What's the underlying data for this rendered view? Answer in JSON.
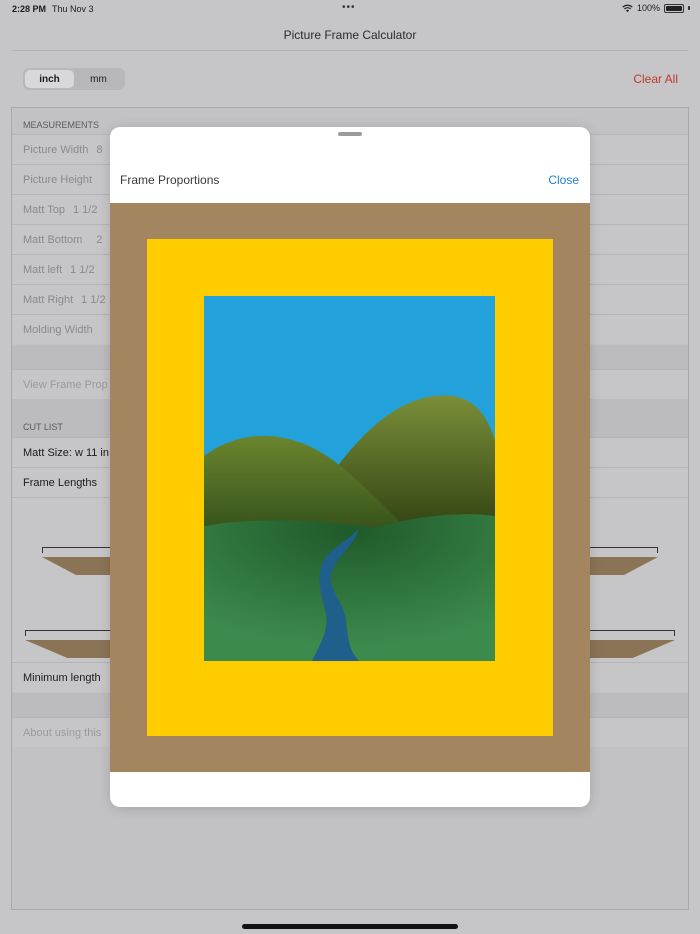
{
  "status_bar": {
    "time": "2:28 PM",
    "date": "Thu Nov 3",
    "battery": "100%",
    "icons": [
      "wifi-icon",
      "battery-icon"
    ]
  },
  "nav": {
    "title": "Picture Frame Calculator"
  },
  "units": {
    "options": [
      "inch",
      "mm"
    ],
    "selected": "inch"
  },
  "toolbar": {
    "clear_all": "Clear All"
  },
  "measurements": {
    "header": "MEASUREMENTS",
    "rows": [
      {
        "label": "Picture Width",
        "value": "8"
      },
      {
        "label": "Picture Height",
        "value": ""
      },
      {
        "label": "Matt Top",
        "value": "1 1/2"
      },
      {
        "label": "Matt Bottom",
        "value": "2"
      },
      {
        "label": "Matt left",
        "value": "1 1/2"
      },
      {
        "label": "Matt Right",
        "value": "1 1/2"
      },
      {
        "label": "Molding Width",
        "value": ""
      }
    ]
  },
  "view_frame": {
    "label": "View Frame Prop"
  },
  "cut_list": {
    "header": "CUT LIST",
    "matt_size": "Matt Size: w 11 in",
    "frame_lengths": "Frame Lengths",
    "minimum_length": "Minimum length"
  },
  "about": {
    "label": "About using this"
  },
  "modal": {
    "title": "Frame Proportions",
    "close_label": "Close",
    "colors": {
      "molding": "#a3855f",
      "matt": "#ffcc00",
      "sky": "#22a1db",
      "hill_back": "#5a7a2a",
      "hill_front": "#3a8a4a",
      "river": "#1f5f8b"
    }
  },
  "colors": {
    "accent": "#1e7fd6",
    "destructive": "#c0392b"
  }
}
